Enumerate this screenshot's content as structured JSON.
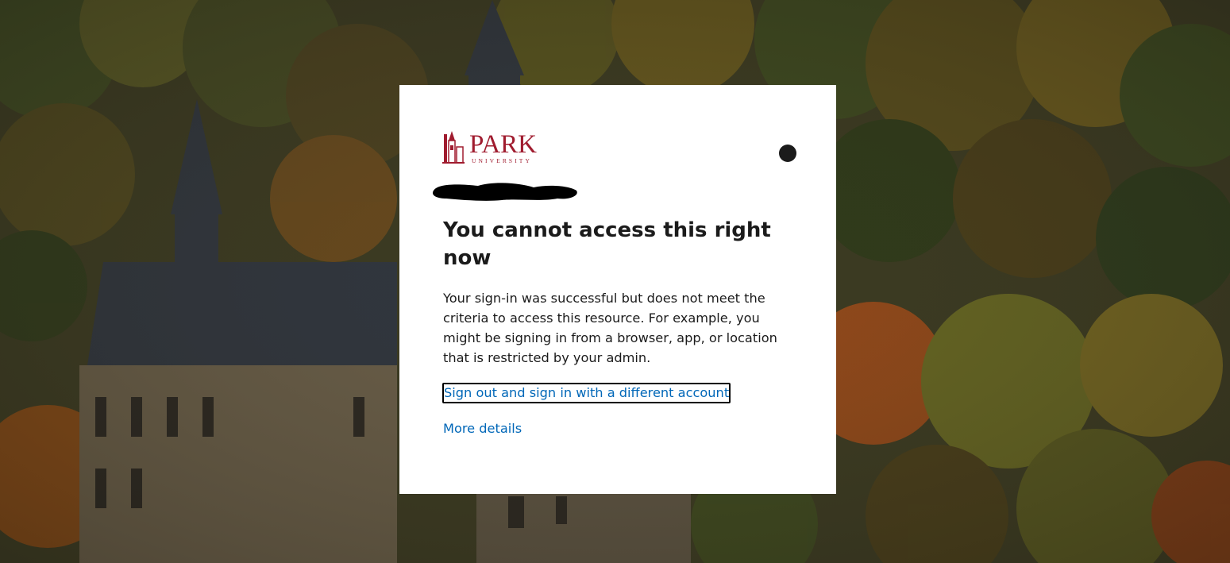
{
  "logo": {
    "wordmark": "PARK",
    "subtitle": "UNIVERSITY",
    "brand_color": "#a01c2f"
  },
  "dialog": {
    "title": "You cannot access this right now",
    "message": "Your sign-in was successful but does not meet the criteria to access this resource. For example, you might be signing in from a browser, app, or location that is restricted by your admin.",
    "signout_link": "Sign out and sign in with a different account",
    "more_details_link": "More details",
    "link_color": "#0067b8",
    "text_color": "#1b1b1b"
  },
  "background": {
    "description_icon": "campus-autumn-photo"
  }
}
